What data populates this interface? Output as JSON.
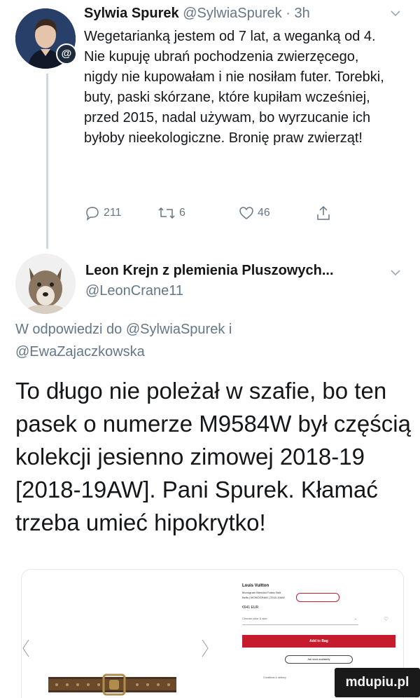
{
  "tweet1": {
    "author_name": "Sylwia Spurek",
    "handle": "@SylwiaSpurek",
    "separator": "·",
    "time": "3h",
    "body": "Wegetarianką jestem od 7 lat, a weganką od 4. Nie kupuję ubrań pochodzenia zwierzęcego, nigdy nie kupowałam i nie nosiłam futer. Torebki, buty, paski skórzane, które kupiłam wcześniej, przed 2015, nadal używam, bo wyrzucanie ich byłoby nieekologiczne. Bronię praw zwierząt!",
    "replies": "211",
    "retweets": "6",
    "likes": "46",
    "badge_icon": "at-badge-icon"
  },
  "tweet2": {
    "author_name": "Leon Krejn z plemienia Pluszowych...",
    "handle": "@LeonCrane11",
    "reply_prefix": "W odpowiedzi do",
    "reply_to_1": "@SylwiaSpurek",
    "reply_join": "i",
    "reply_to_2": "@EwaZajaczkowska",
    "body": "To długo nie poleżał w szafie, bo ten pasek o numerze M9584W był częścią kolekcji jesienno zimowej 2018-19 [2018-19AW]. Pani Spurek. Kłamać trzeba umieć hipokrytko!"
  },
  "product": {
    "brand": "Louis Vuitton",
    "line1": "Monogram Blended Fabric Belt",
    "line2": "Belts | MONOGRAM | 2018-19AW",
    "price": "€641 EUR",
    "select_label": "Choose color & size",
    "add_button": "Add to Bag",
    "availability_button": "Ask stock availability",
    "footer_text": "Conditions & delivery"
  },
  "watermark": "mdupiu.pl",
  "colors": {
    "text": "#14171a",
    "muted": "#657786",
    "line": "#cfd9de",
    "add_button": "#c61b2d"
  }
}
